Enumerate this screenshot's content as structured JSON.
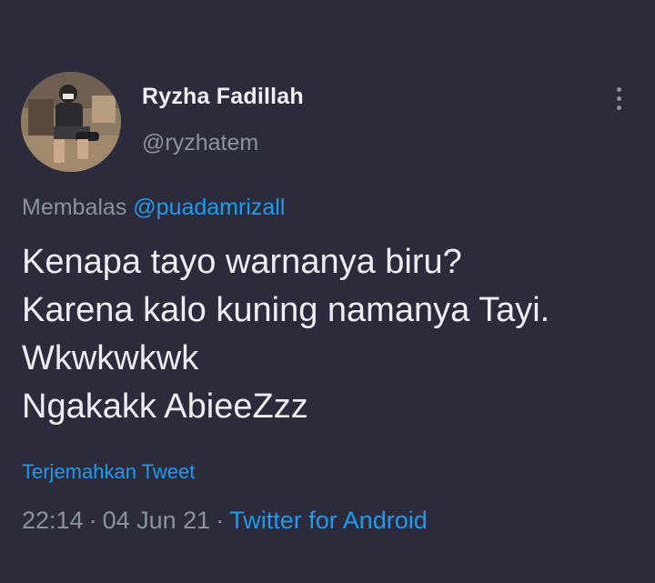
{
  "author": {
    "display_name": "Ryzha Fadillah",
    "handle": "@ryzhatem",
    "avatar_icon": "profile-photo"
  },
  "reply": {
    "prefix": "Membalas",
    "mention": "@puadamrizall"
  },
  "tweet": {
    "lines": [
      "Kenapa tayo warnanya biru?",
      "Karena kalo kuning namanya Tayi.",
      "Wkwkwkwk",
      "Ngakakk AbieeZzz"
    ]
  },
  "translate_label": "Terjemahkan Tweet",
  "meta": {
    "time": "22:14",
    "date": "04 Jun 21",
    "separator": "·",
    "source": "Twitter for Android"
  },
  "more_icon": "more-vertical-icon",
  "colors": {
    "background": "#2b2b3c",
    "link": "#1d9bf0",
    "secondary_text": "#8b93a0",
    "primary_text": "#eceef1"
  }
}
